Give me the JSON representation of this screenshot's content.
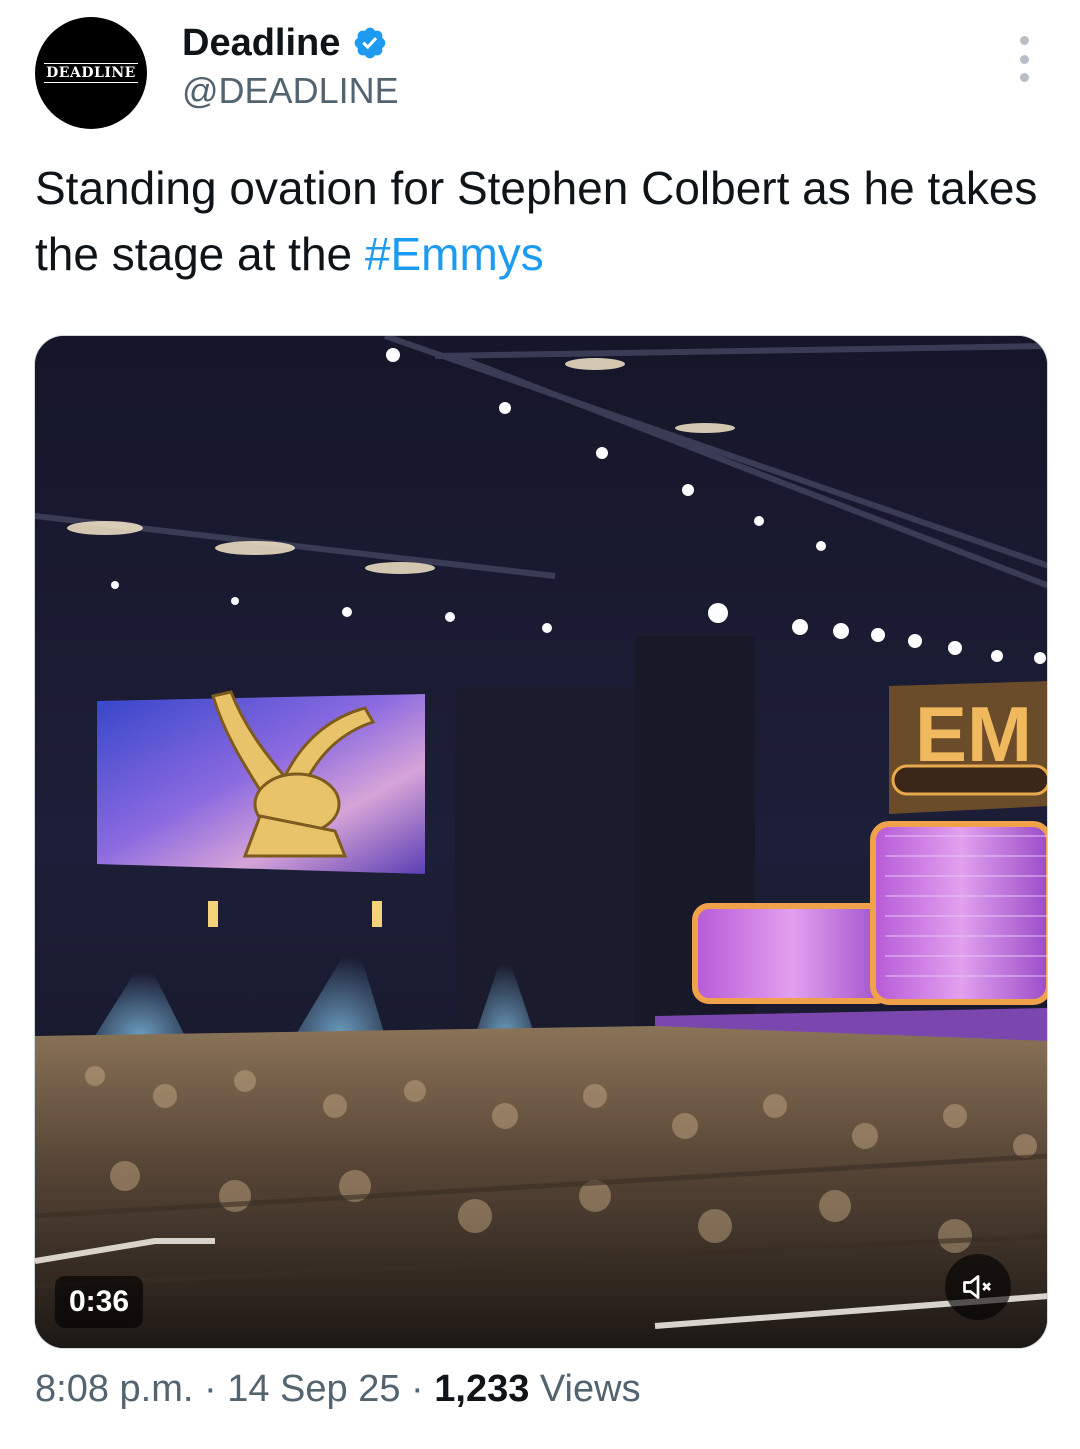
{
  "account": {
    "avatar_text": "DEADLINE",
    "display_name": "Deadline",
    "handle": "@DEADLINE",
    "verified": true,
    "verified_color": "#1d9bf0"
  },
  "tweet": {
    "text_main": "Standing ovation for Stephen Colbert as he takes the stage at the ",
    "hashtag": "#Emmys",
    "hashtag_color": "#1d9bf0"
  },
  "media": {
    "type": "video",
    "duration": "0:36",
    "stage_sign": "EM",
    "muted": true
  },
  "meta": {
    "time": "8:08 p.m.",
    "separator1": " · ",
    "date": "14 Sep 25",
    "separator2": " · ",
    "views_count": "1,233",
    "views_label": " Views"
  }
}
